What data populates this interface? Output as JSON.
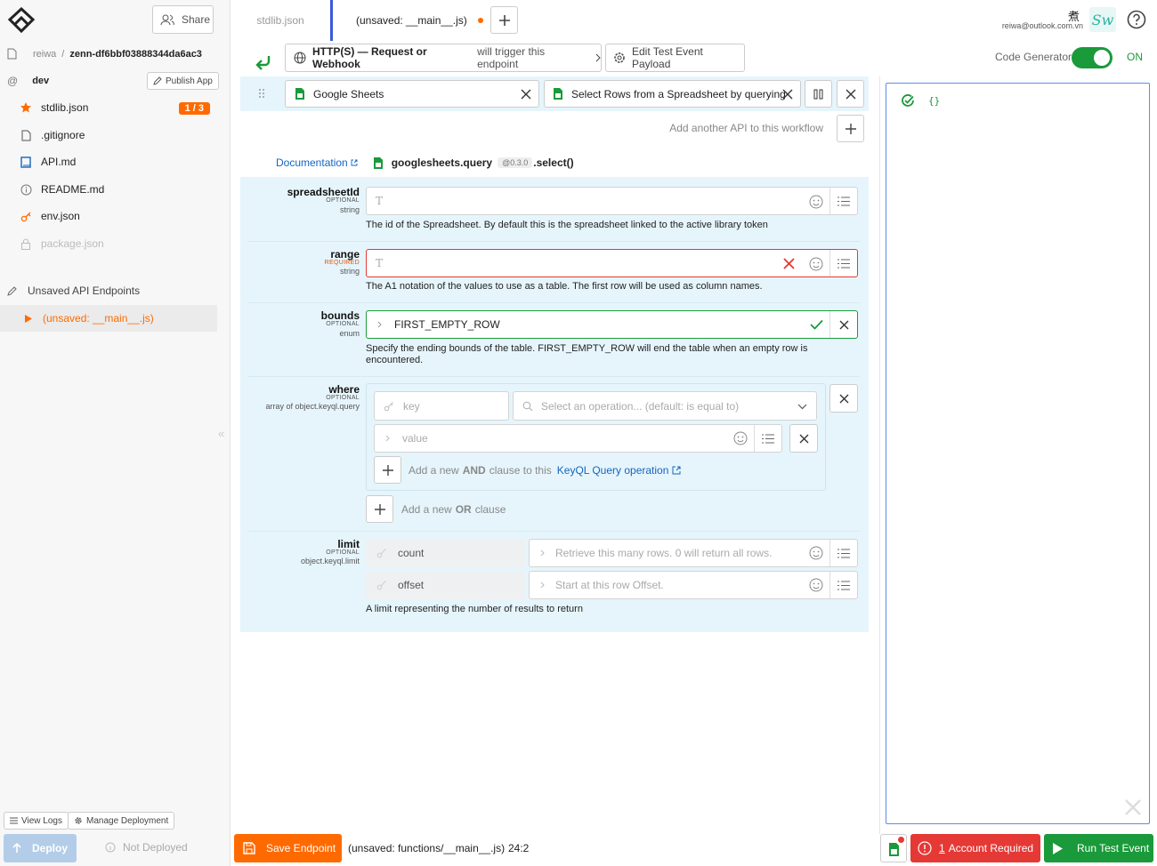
{
  "colors": {
    "accent_orange": "#ff6a00",
    "accent_green": "#1a9a3a",
    "panel_blue": "#e6f5fc",
    "error_red": "#e53935",
    "link_blue": "#1565c0"
  },
  "header": {
    "share_label": "Share",
    "tabs": [
      {
        "label": "stdlib.json"
      },
      {
        "label": "(unsaved: __main__.js)"
      }
    ],
    "user_email": "reiwa@outlook.com.vn",
    "user_glyph": "煮",
    "user_logo": "Sw"
  },
  "sidebar": {
    "account": "reiwa",
    "separator": "/",
    "project": "zenn-df6bbf03888344da6ac3",
    "env": "dev",
    "publish_label": "Publish App",
    "files": [
      {
        "label": "stdlib.json",
        "badge": "1 / 3"
      },
      {
        "label": ".gitignore"
      },
      {
        "label": "API.md"
      },
      {
        "label": "README.md"
      },
      {
        "label": "env.json"
      },
      {
        "label": "package.json"
      }
    ],
    "section_label": "Unsaved API Endpoints",
    "endpoint_label": "(unsaved: __main__.js)",
    "view_logs_label": "View Logs",
    "manage_label": "Manage Deployment",
    "deploy_label": "Deploy",
    "status_label": "Not Deployed"
  },
  "trigger": {
    "type_label": "HTTP(S) — Request or Webhook",
    "suffix": "will trigger this endpoint",
    "edit_payload_label": "Edit Test Event Payload"
  },
  "code_generator": {
    "label": "Code Generator",
    "state": "ON"
  },
  "step": {
    "api_label": "Google Sheets",
    "method_label": "Select Rows from a Spreadsheet by querying",
    "add_api_label": "Add another API to this workflow",
    "doc_label": "Documentation",
    "module": "googlesheets.query",
    "version": "@0.3.0",
    "method_suffix": ".select()"
  },
  "params": {
    "spreadsheetId": {
      "name": "spreadsheetId",
      "req": "OPTIONAL",
      "type": "string",
      "desc": "The id of the Spreadsheet. By default this is the spreadsheet linked to the active library token"
    },
    "range": {
      "name": "range",
      "req": "REQUIRED",
      "type": "string",
      "desc": "The A1 notation of the values to use as a table. The first row will be used as column names."
    },
    "bounds": {
      "name": "bounds",
      "req": "OPTIONAL",
      "type": "enum",
      "value": "FIRST_EMPTY_ROW",
      "desc": "Specify the ending bounds of the table. FIRST_EMPTY_ROW will end the table when an empty row is encountered."
    },
    "where": {
      "name": "where",
      "req": "OPTIONAL",
      "type": "array of object.keyql.query",
      "key_placeholder": "key",
      "op_placeholder": "Select an operation... (default: is equal to)",
      "value_placeholder": "value",
      "and_prefix": "Add a new",
      "and_word": "AND",
      "and_suffix": "clause to this",
      "and_link": "KeyQL Query operation",
      "or_prefix": "Add a new",
      "or_word": "OR",
      "or_suffix": "clause"
    },
    "limit": {
      "name": "limit",
      "req": "OPTIONAL",
      "type": "object.keyql.limit",
      "count_label": "count",
      "count_placeholder": "Retrieve this many rows. 0 will return all rows.",
      "offset_label": "offset",
      "offset_placeholder": "Start at this row Offset.",
      "desc": "A limit representing the number of results to return"
    }
  },
  "code_panel": {
    "text": "{}"
  },
  "footer": {
    "save_label": "Save Endpoint",
    "file_path": "(unsaved: functions/__main__.js)",
    "cursor": "24:2",
    "account_required_count": "1",
    "account_required_label": "Account Required",
    "run_label": "Run Test Event"
  }
}
